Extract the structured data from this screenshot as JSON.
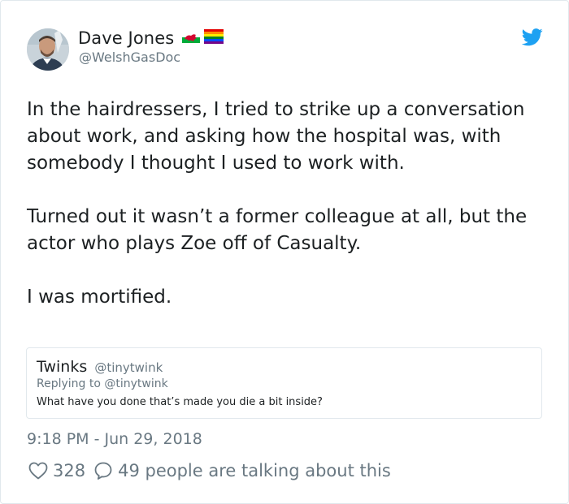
{
  "author": {
    "name": "Dave Jones",
    "handle": "@WelshGasDoc",
    "flags": [
      "wales-flag-icon",
      "rainbow-flag-icon"
    ]
  },
  "tweet": {
    "paragraphs": [
      "In the hairdressers, I tried to strike up a conversation about work, and asking how the hospital was, with somebody I thought I used to work with.",
      "Turned out it wasn’t a former colleague at all, but the actor who plays Zoe off of Casualty.",
      "I was mortified."
    ]
  },
  "quoted": {
    "name": "Twinks",
    "handle": "@tinytwink",
    "replying_to": "Replying to @tinytwink",
    "text": "What have you done that’s made you die a bit inside?"
  },
  "timestamp": "9:18 PM - Jun 29, 2018",
  "engagement": {
    "likes": "328",
    "replies_text": "49 people are talking about this"
  },
  "colors": {
    "text": "#1c2022",
    "muted": "#697882",
    "twitter_blue": "#1da1f2",
    "border": "#e1e8ed"
  }
}
